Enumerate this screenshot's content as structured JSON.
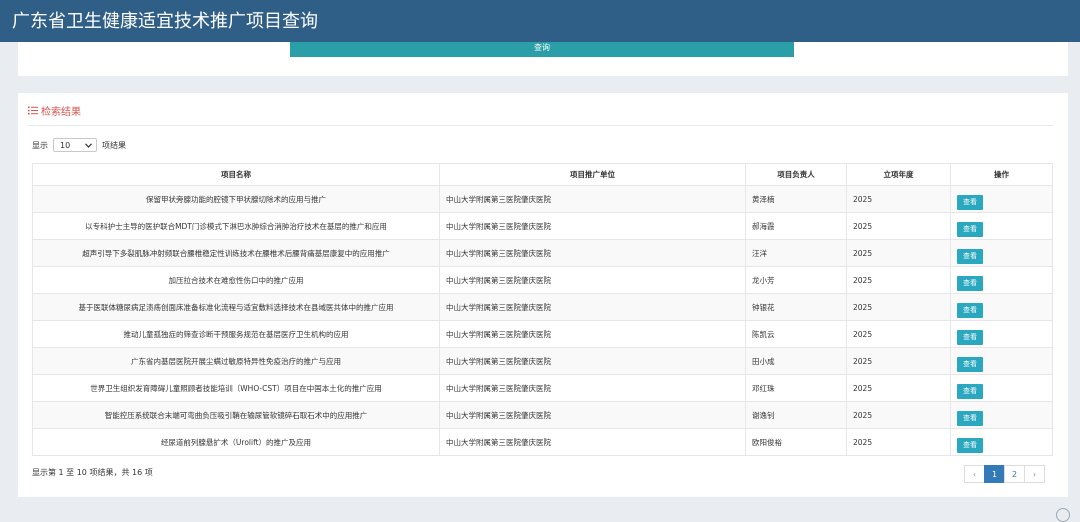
{
  "header": {
    "title": "广东省卫生健康适宜技术推广项目查询"
  },
  "search": {
    "button_label": "查询"
  },
  "results": {
    "title": "检索结果",
    "length_prefix": "显示",
    "length_value": "10",
    "length_suffix": "项结果",
    "columns": [
      "项目名称",
      "项目推广单位",
      "项目负责人",
      "立项年度",
      "操作"
    ],
    "rows": [
      {
        "name": "保留甲状旁腺功能的腔镜下甲状腺切除术的应用与推广",
        "unit": "中山大学附属第三医院肇庆医院",
        "leader": "黄泽楠",
        "year": "2025",
        "action": "查看"
      },
      {
        "name": "以专科护士主导的医护联合MDT门诊模式下淋巴水肿综合消肿治疗技术在基层的推广和应用",
        "unit": "中山大学附属第三医院肇庆医院",
        "leader": "郝海霞",
        "year": "2025",
        "action": "查看"
      },
      {
        "name": "超声引导下多裂肌脉冲射频联合腰椎稳定性训练技术在腰椎术后腰背痛基层康复中的应用推广",
        "unit": "中山大学附属第三医院肇庆医院",
        "leader": "汪洋",
        "year": "2025",
        "action": "查看"
      },
      {
        "name": "加压拉合技术在难愈性伤口中的推广应用",
        "unit": "中山大学附属第三医院肇庆医院",
        "leader": "龙小芳",
        "year": "2025",
        "action": "查看"
      },
      {
        "name": "基于医联体糖尿病足溃疡创面床准备标准化流程与适宜敷料选择技术在县域医共体中的推广应用",
        "unit": "中山大学附属第三医院肇庆医院",
        "leader": "钟银花",
        "year": "2025",
        "action": "查看"
      },
      {
        "name": "推动儿童孤独症的筛查诊断干预服务规范在基层医疗卫生机构的应用",
        "unit": "中山大学附属第三医院肇庆医院",
        "leader": "陈凯云",
        "year": "2025",
        "action": "查看"
      },
      {
        "name": "广东省内基层医院开展尘螨过敏原特异性免疫治疗的推广与应用",
        "unit": "中山大学附属第三医院肇庆医院",
        "leader": "田小成",
        "year": "2025",
        "action": "查看"
      },
      {
        "name": "世界卫生组织发育障碍儿童照顾者技能培训（WHO-CST）项目在中国本土化的推广应用",
        "unit": "中山大学附属第三医院肇庆医院",
        "leader": "邓红珠",
        "year": "2025",
        "action": "查看"
      },
      {
        "name": "智能控压系统联合末端可弯曲负压吸引鞘在输尿管软镜碎石取石术中的应用推广",
        "unit": "中山大学附属第三医院肇庆医院",
        "leader": "谢逸钊",
        "year": "2025",
        "action": "查看"
      },
      {
        "name": "经尿道前列腺悬扩术（Urolift）的推广及应用",
        "unit": "中山大学附属第三医院肇庆医院",
        "leader": "欧阳俊裕",
        "year": "2025",
        "action": "查看"
      }
    ],
    "info": "显示第 1 至 10 项结果，共 16 项",
    "pagination": {
      "prev": "‹",
      "pages": [
        "1",
        "2"
      ],
      "next": "›"
    }
  }
}
